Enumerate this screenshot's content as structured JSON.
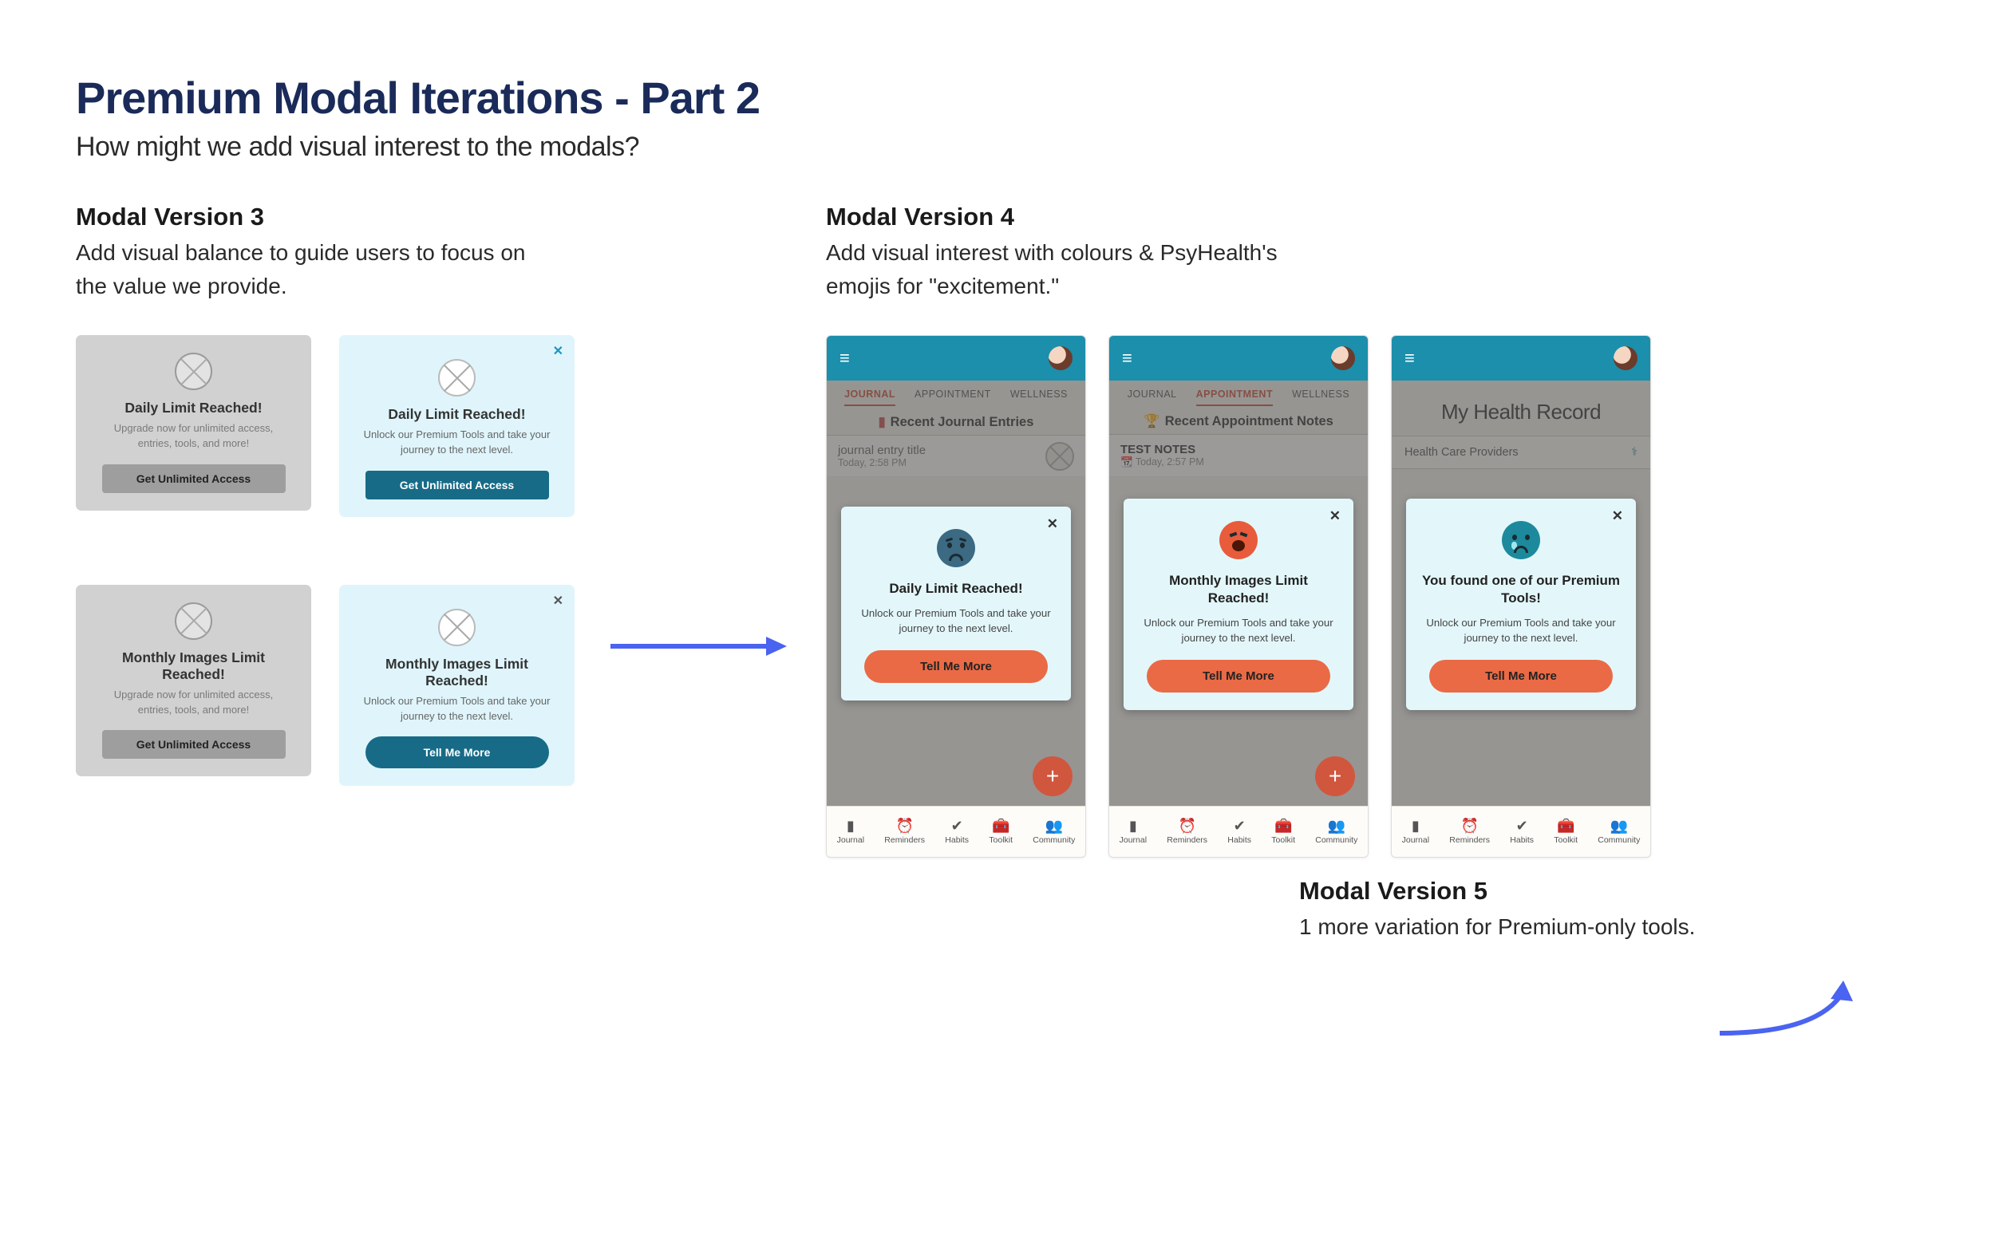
{
  "page": {
    "title": "Premium Modal Iterations - Part 2",
    "subtitle": "How might we add visual interest to the modals?"
  },
  "v3": {
    "title": "Modal Version 3",
    "desc": "Add visual balance to guide users to focus on the value we provide.",
    "cardA": {
      "title": "Daily Limit Reached!",
      "desc": "Upgrade now for unlimited access, entries, tools, and more!",
      "btn": "Get Unlimited Access"
    },
    "cardB": {
      "title": "Daily Limit Reached!",
      "desc": "Unlock our Premium Tools and take your journey to the next level.",
      "btn": "Get Unlimited Access"
    },
    "cardC": {
      "title": "Monthly Images Limit Reached!",
      "desc": "Upgrade now for unlimited access, entries, tools, and more!",
      "btn": "Get Unlimited Access"
    },
    "cardD": {
      "title": "Monthly Images Limit Reached!",
      "desc": "Unlock our Premium Tools and take your journey to the next level.",
      "btn": "Tell Me More"
    }
  },
  "v4": {
    "title": "Modal Version 4",
    "desc": "Add visual interest with colours & PsyHealth's emojis for \"excitement.\""
  },
  "v5": {
    "title": "Modal Version 5",
    "desc": "1 more variation for Premium-only tools."
  },
  "phones": {
    "tabs": {
      "journal": "JOURNAL",
      "appointment": "APPOINTMENT",
      "wellness": "WELLNESS"
    },
    "p1": {
      "section": "Recent Journal Entries",
      "entryTitle": "journal entry title",
      "entryTime": "Today, 2:58 PM",
      "modalTitle": "Daily Limit Reached!",
      "modalDesc": "Unlock our Premium Tools and take your journey to the next level.",
      "btn": "Tell Me More"
    },
    "p2": {
      "section": "Recent Appointment Notes",
      "entryTitle": "TEST NOTES",
      "entryTime": "Today, 2:57 PM",
      "modalTitle": "Monthly Images Limit Reached!",
      "modalDesc": "Unlock our Premium Tools and take your journey to the next level.",
      "btn": "Tell Me More"
    },
    "p3": {
      "header": "My Health Record",
      "row": "Health Care Providers",
      "modalTitle": "You found one of our Premium Tools!",
      "modalDesc": "Unlock our Premium Tools and take your journey to the next level.",
      "btn": "Tell Me More"
    },
    "nav": {
      "journal": "Journal",
      "reminders": "Reminders",
      "habits": "Habits",
      "toolkit": "Toolkit",
      "community": "Community"
    }
  },
  "icons": {
    "close": "✕",
    "plus": "+",
    "hamburger": "≡",
    "book": "▮",
    "trophy": "🏆",
    "cal": "📆",
    "steth": "⚕"
  }
}
